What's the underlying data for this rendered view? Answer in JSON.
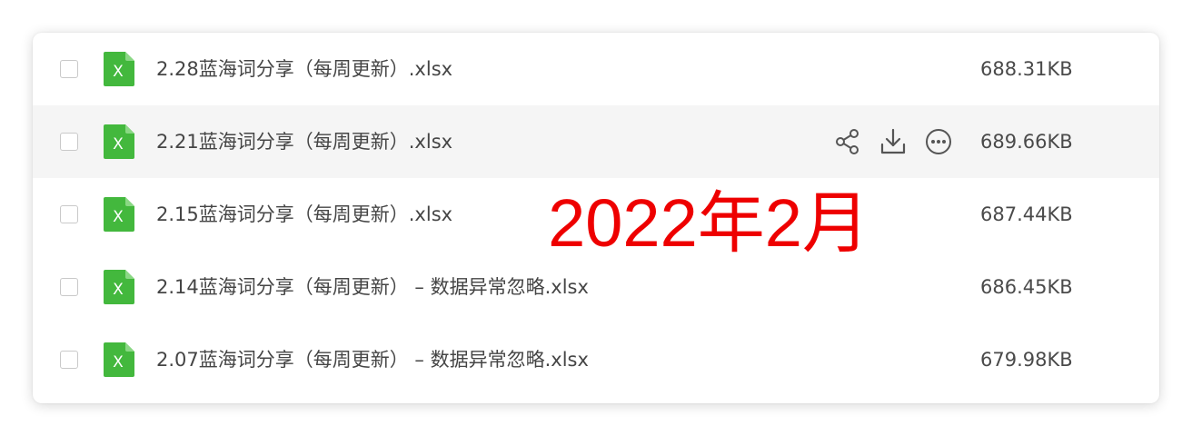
{
  "file_list": {
    "files": [
      {
        "name": "2.28蓝海词分享（每周更新）.xlsx",
        "size": "688.31KB",
        "type": "xlsx"
      },
      {
        "name": "2.21蓝海词分享（每周更新）.xlsx",
        "size": "689.66KB",
        "type": "xlsx",
        "hovered": true
      },
      {
        "name": "2.15蓝海词分享（每周更新）.xlsx",
        "size": "687.44KB",
        "type": "xlsx"
      },
      {
        "name": "2.14蓝海词分享（每周更新） – 数据异常忽略.xlsx",
        "size": "686.45KB",
        "type": "xlsx"
      },
      {
        "name": "2.07蓝海词分享（每周更新） – 数据异常忽略.xlsx",
        "size": "679.98KB",
        "type": "xlsx"
      }
    ],
    "row_actions": [
      "share-icon",
      "download-icon",
      "more-icon"
    ],
    "file_icon_letter": "X"
  },
  "overlay": {
    "text": "2022年2月",
    "color": "#ee0000"
  },
  "colors": {
    "excel_green": "#43b83d",
    "hover_bg": "#f5f5f5",
    "icon_gray": "#555555"
  }
}
